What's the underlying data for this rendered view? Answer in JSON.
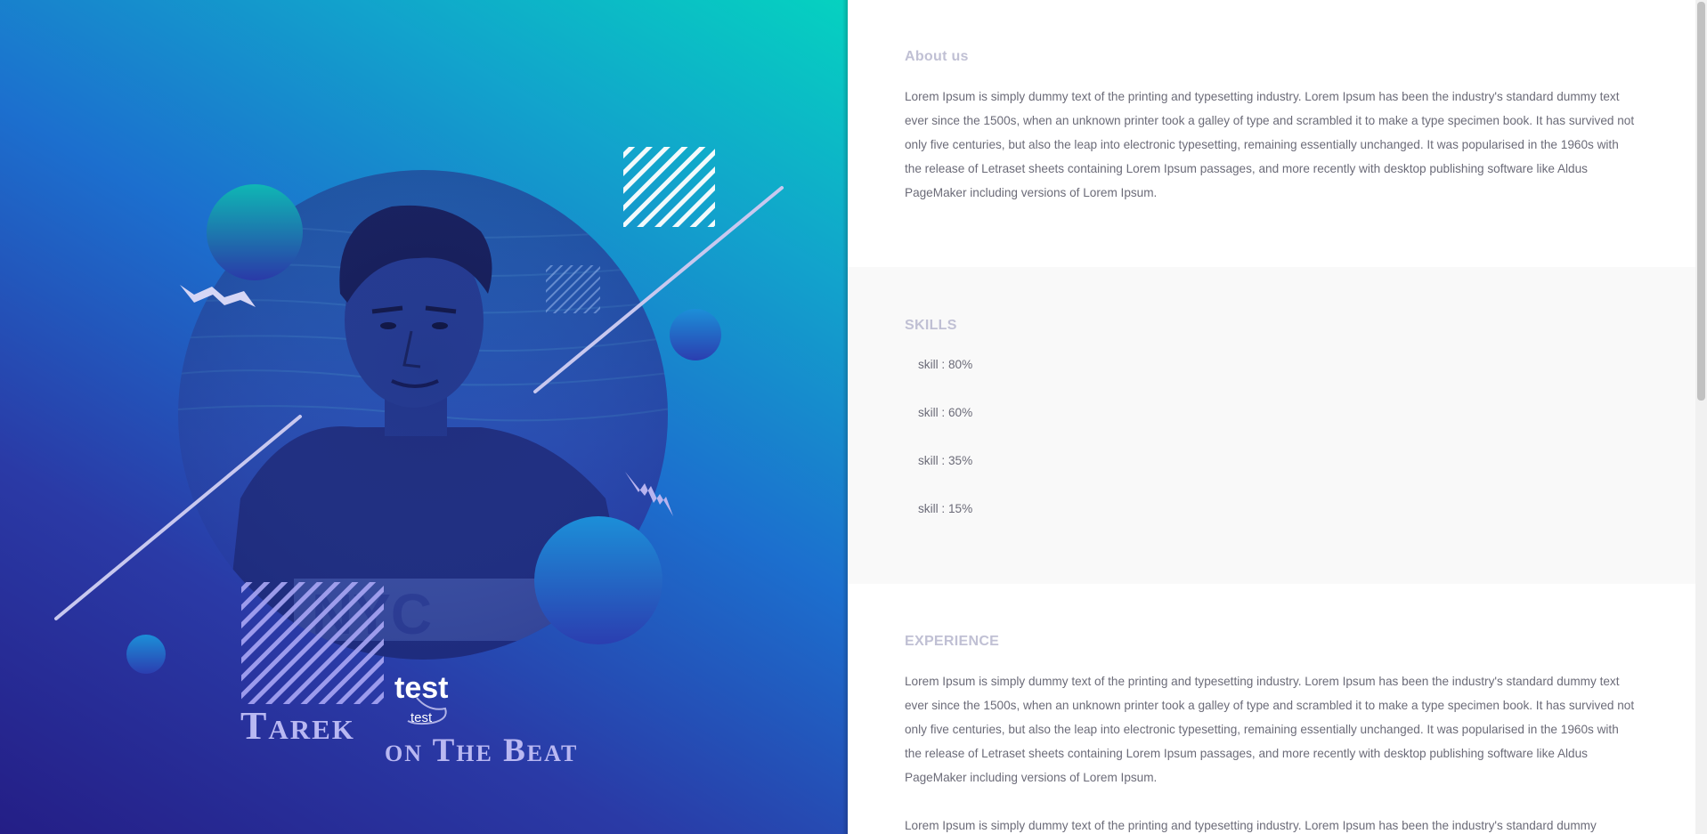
{
  "hero": {
    "title": "test",
    "subtitle": "test",
    "name_line1": "Tarek",
    "name_line2": "on The Beat",
    "colors": {
      "gradient_start": "#241e86",
      "gradient_mid": "#1c6fce",
      "gradient_end": "#05d2c0"
    },
    "photo_icon": "portrait-photo"
  },
  "about": {
    "heading": "About us",
    "body": "Lorem Ipsum is simply dummy text of the printing and typesetting industry. Lorem Ipsum has been the industry's standard dummy text ever since the 1500s, when an unknown printer took a galley of type and scrambled it to make a type specimen book. It has survived not only five centuries, but also the leap into electronic typesetting, remaining essentially unchanged. It was popularised in the 1960s with the release of Letraset sheets containing Lorem Ipsum passages, and more recently with desktop publishing software like Aldus PageMaker including versions of Lorem Ipsum."
  },
  "skills": {
    "heading": "SKILLS",
    "items": [
      {
        "label": "skill : 80%",
        "level": 0.8
      },
      {
        "label": "skill : 60%",
        "level": 0.6
      },
      {
        "label": "skill : 35%",
        "level": 0.35
      },
      {
        "label": "skill : 15%",
        "level": 0.15
      }
    ]
  },
  "experience": {
    "heading": "EXPERIENCE",
    "paragraphs": [
      "Lorem Ipsum is simply dummy text of the printing and typesetting industry. Lorem Ipsum has been the industry's standard dummy text ever since the 1500s, when an unknown printer took a galley of type and scrambled it to make a type specimen book. It has survived not only five centuries, but also the leap into electronic typesetting, remaining essentially unchanged. It was popularised in the 1960s with the release of Letraset sheets containing Lorem Ipsum passages, and more recently with desktop publishing software like Aldus PageMaker including versions of Lorem Ipsum.",
      "Lorem Ipsum is simply dummy text of the printing and typesetting industry. Lorem Ipsum has been the industry's standard dummy"
    ]
  },
  "colors": {
    "heading": "#c0c0d4",
    "body_text": "#6b6b78",
    "skills_bg": "#f9f9f9"
  }
}
